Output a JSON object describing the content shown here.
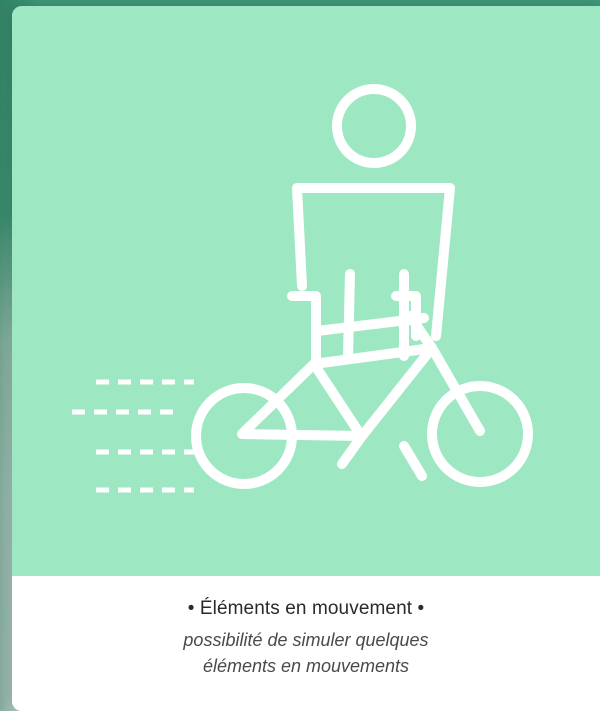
{
  "card": {
    "title": "• Éléments en mouvement •",
    "description_line1": "possibilité de simuler quelques",
    "description_line2": "éléments en mouvements"
  },
  "illustration": {
    "icon": "cyclist-in-motion-icon",
    "background_color": "#9de8c3",
    "stroke_color": "#ffffff"
  }
}
